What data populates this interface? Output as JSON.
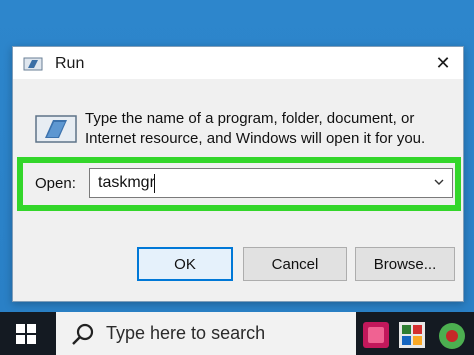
{
  "dialog": {
    "title": "Run",
    "close_glyph": "✕",
    "description": "Type the name of a program, folder, document, or Internet resource, and Windows will open it for you.",
    "open_label": "Open:",
    "open_value": "taskmgr",
    "buttons": {
      "ok": "OK",
      "cancel": "Cancel",
      "browse": "Browse..."
    },
    "icons": [
      "run-icon",
      "close-icon",
      "chevron-down-icon"
    ]
  },
  "taskbar": {
    "search_placeholder": "Type here to search",
    "icons": [
      "windows-start-icon",
      "search-icon",
      "app-icon",
      "app-icon",
      "app-icon"
    ]
  },
  "colors": {
    "desktop": "#2b7fc4",
    "highlight": "#33d62a",
    "taskbar": "#141a22",
    "ok_border": "#0078d7"
  }
}
